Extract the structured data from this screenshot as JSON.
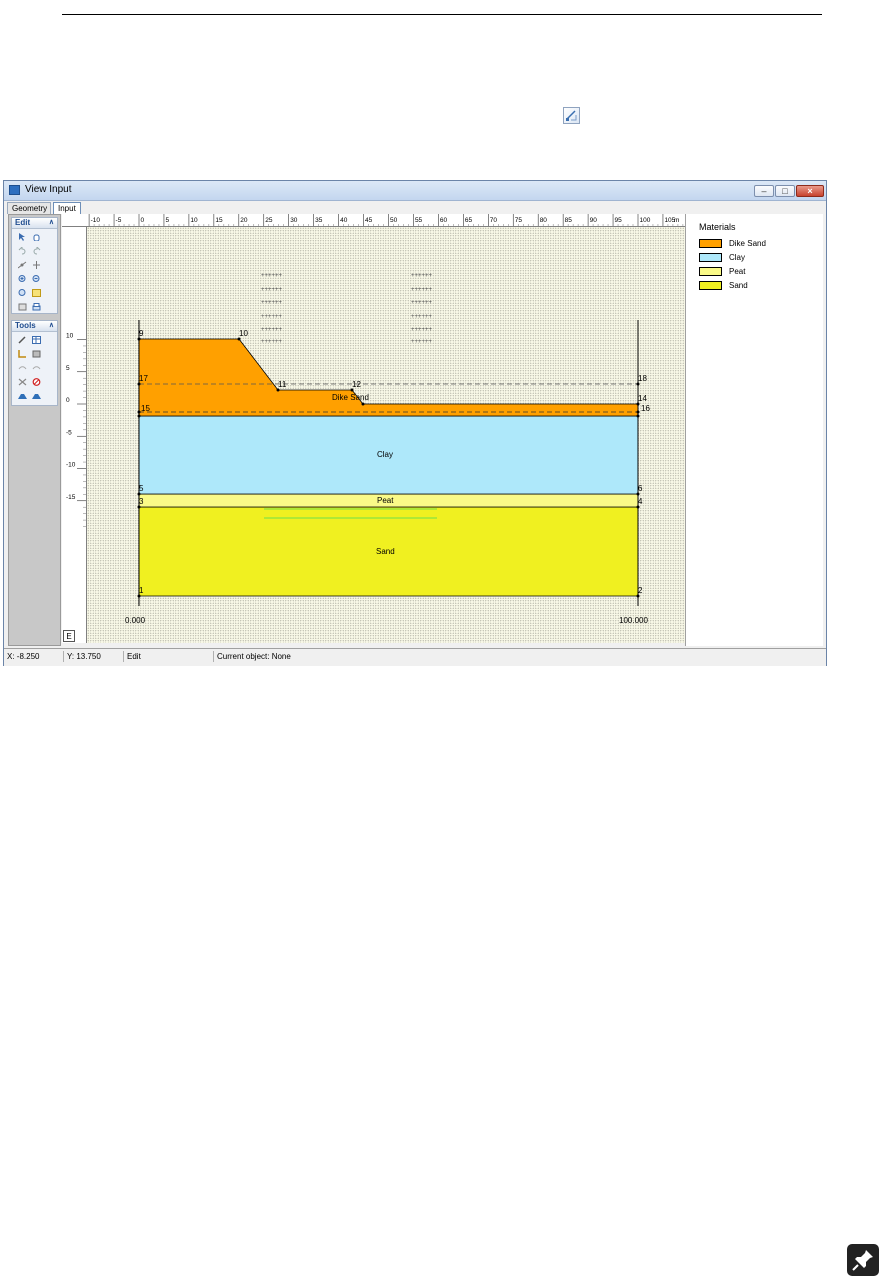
{
  "window": {
    "title": "View Input"
  },
  "tabs": [
    {
      "label": "Geometry"
    },
    {
      "label": "Input"
    }
  ],
  "sidebar": {
    "edit": {
      "title": "Edit",
      "tools": [
        "select-tool",
        "pan-tool",
        "undo-tool",
        "redo-tool",
        "add-point-tool",
        "move-tool",
        "zoom-in-tool",
        "zoom-out-tool",
        "zoom-limits-tool",
        "zoom-area-tool",
        "properties-tool",
        "print-tool"
      ]
    },
    "tools": {
      "title": "Tools",
      "tools": [
        "edit-tool",
        "table-tool",
        "ruler-tool",
        "layers-tool",
        "connect-tool",
        "disconnect-tool",
        "delete-tool",
        "no-entry-tool",
        "pl-line-tool",
        "boundary-tool"
      ]
    }
  },
  "ruler": {
    "x_ticks": [
      "-10",
      "-5",
      "0",
      "5",
      "10",
      "15",
      "20",
      "25",
      "30",
      "35",
      "40",
      "45",
      "50",
      "55",
      "60",
      "65",
      "70",
      "75",
      "80",
      "85",
      "90",
      "95",
      "100",
      "105"
    ],
    "x_unit": "m",
    "y_ticks": [
      "10",
      "5",
      "0",
      "-5",
      "-10",
      "-15"
    ]
  },
  "geometry": {
    "layers": [
      {
        "name": "Dike Sand",
        "color": "#ffa000"
      },
      {
        "name": "Clay",
        "color": "#aee8fa"
      },
      {
        "name": "Peat",
        "color": "#fafa88"
      },
      {
        "name": "Sand",
        "color": "#f0f020"
      }
    ],
    "points": [
      "1",
      "2",
      "3",
      "4",
      "5",
      "6",
      "9",
      "10",
      "11",
      "12",
      "14",
      "15",
      "16",
      "17",
      "18"
    ],
    "x_labels": {
      "left": "0.000",
      "right": "100.000"
    },
    "zoom_label": "E"
  },
  "legend": {
    "title": "Materials",
    "items": [
      {
        "label": "Dike Sand",
        "color": "#ffa000"
      },
      {
        "label": "Clay",
        "color": "#aee8fa"
      },
      {
        "label": "Peat",
        "color": "#fafa88"
      },
      {
        "label": "Sand",
        "color": "#f0f020"
      }
    ]
  },
  "status": {
    "x": "X: -8.250",
    "y": "Y: 13.750",
    "mode": "Edit",
    "current_object": "Current object: None"
  }
}
